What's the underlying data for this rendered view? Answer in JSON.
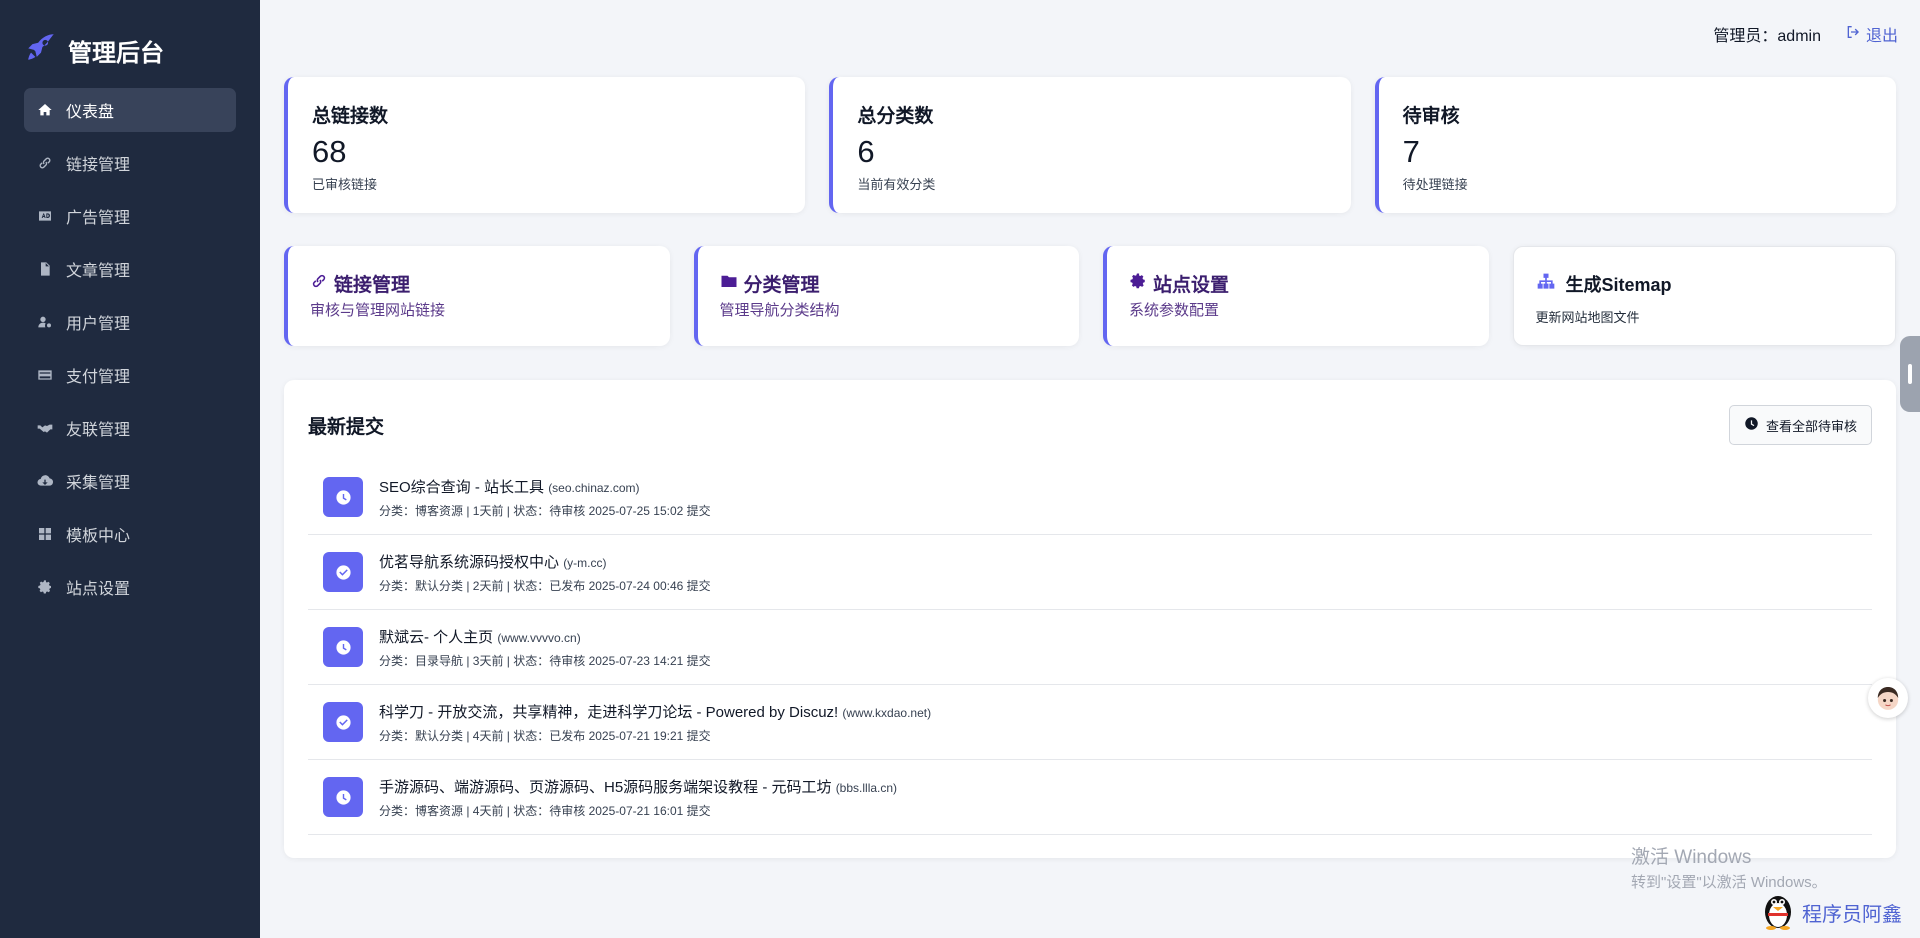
{
  "brand": {
    "title": "管理后台"
  },
  "sidebar": {
    "items": [
      {
        "label": "仪表盘",
        "icon": "home-icon",
        "active": true
      },
      {
        "label": "链接管理",
        "icon": "link-icon"
      },
      {
        "label": "广告管理",
        "icon": "ad-icon"
      },
      {
        "label": "文章管理",
        "icon": "file-icon"
      },
      {
        "label": "用户管理",
        "icon": "user-gear-icon"
      },
      {
        "label": "支付管理",
        "icon": "credit-card-icon"
      },
      {
        "label": "友联管理",
        "icon": "handshake-icon"
      },
      {
        "label": "采集管理",
        "icon": "cloud-download-icon"
      },
      {
        "label": "模板中心",
        "icon": "grid-icon"
      },
      {
        "label": "站点设置",
        "icon": "gear-icon"
      }
    ]
  },
  "topbar": {
    "admin_label": "管理员：admin",
    "logout_label": "退出"
  },
  "stats": [
    {
      "label": "总链接数",
      "value": "68",
      "sub": "已审核链接"
    },
    {
      "label": "总分类数",
      "value": "6",
      "sub": "当前有效分类"
    },
    {
      "label": "待审核",
      "value": "7",
      "sub": "待处理链接"
    }
  ],
  "quick": [
    {
      "title": "链接管理",
      "sub": "审核与管理网站链接",
      "icon": "link-icon"
    },
    {
      "title": "分类管理",
      "sub": "管理导航分类结构",
      "icon": "folder-icon"
    },
    {
      "title": "站点设置",
      "sub": "系统参数配置",
      "icon": "gear-icon"
    },
    {
      "title": "生成Sitemap",
      "sub": "更新网站地图文件",
      "icon": "sitemap-icon"
    }
  ],
  "latest": {
    "title": "最新提交",
    "view_all_label": "查看全部待审核",
    "items": [
      {
        "title": "SEO综合查询 - 站长工具",
        "domain": "(seo.chinaz.com)",
        "meta": "分类：博客资源 | 1天前 | 状态：待审核 2025-07-25 15:02 提交",
        "status_icon": "clock-icon"
      },
      {
        "title": "优茗导航系统源码授权中心",
        "domain": "(y-m.cc)",
        "meta": "分类：默认分类 | 2天前 | 状态：已发布 2025-07-24 00:46 提交",
        "status_icon": "check-circle-icon"
      },
      {
        "title": "默斌云- 个人主页",
        "domain": "(www.vvvvo.cn)",
        "meta": "分类：目录导航 | 3天前 | 状态：待审核 2025-07-23 14:21 提交",
        "status_icon": "clock-icon"
      },
      {
        "title": "科学刀 - 开放交流，共享精神，走进科学刀论坛 - Powered by Discuz!",
        "domain": "(www.kxdao.net)",
        "meta": "分类：默认分类 | 4天前 | 状态：已发布 2025-07-21 19:21 提交",
        "status_icon": "check-circle-icon"
      },
      {
        "title": "手游源码、端游源码、页游源码、H5源码服务端架设教程 - 元码工坊",
        "domain": "(bbs.llla.cn)",
        "meta": "分类：博客资源 | 4天前 | 状态：待审核 2025-07-21 16:01 提交",
        "status_icon": "clock-icon"
      }
    ]
  },
  "watermark": {
    "line1": "激活 Windows",
    "line2": "转到\"设置\"以激活 Windows。"
  },
  "author": {
    "label": "程序员阿鑫"
  },
  "colors": {
    "sidebar": "#1f2a3f",
    "accent": "#6366f1",
    "active_nav": "#38435a"
  }
}
